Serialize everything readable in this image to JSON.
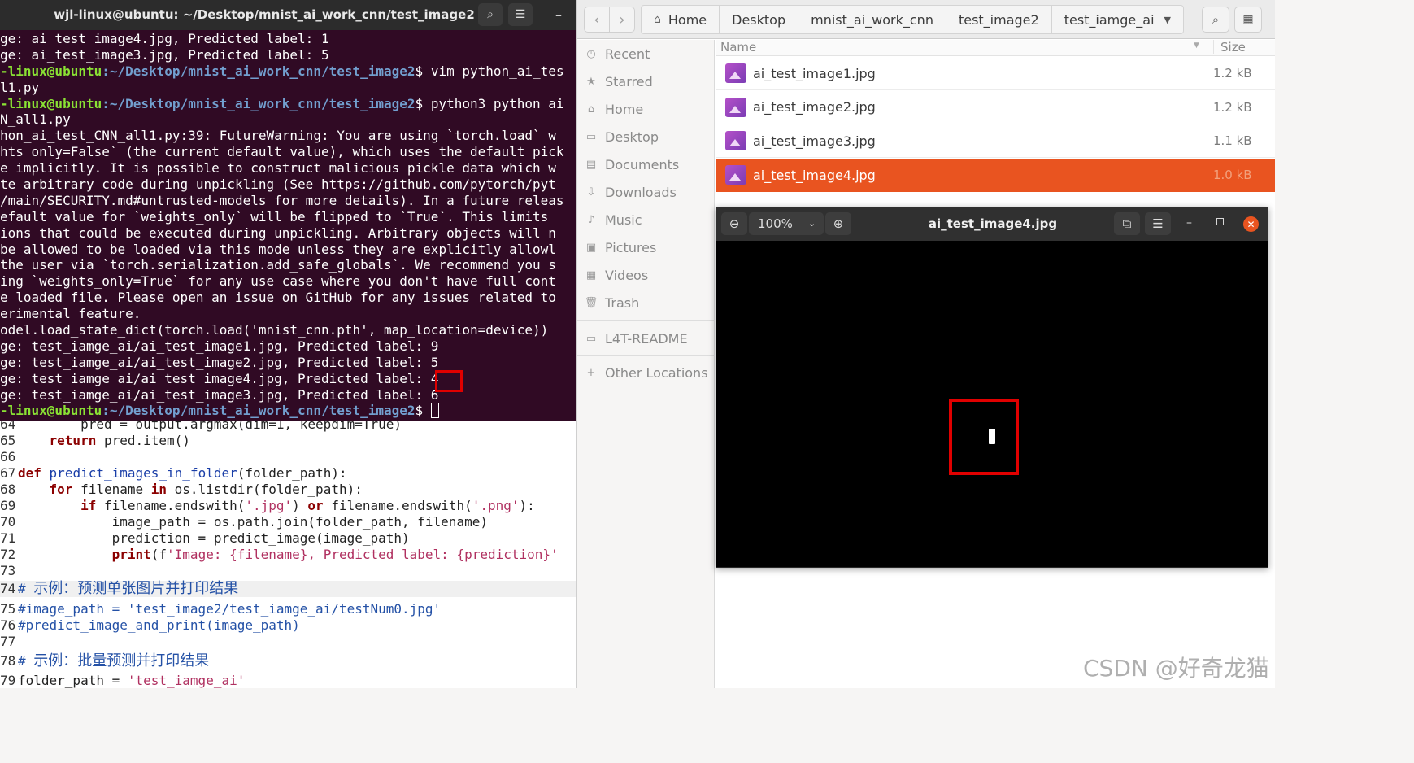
{
  "terminal": {
    "title": "wjl-linux@ubuntu: ~/Desktop/mnist_ai_work_cnn/test_image2",
    "icons": {
      "search": "search-icon",
      "menu": "hamburger-menu-icon",
      "minimize": "minimize-icon"
    },
    "lines": [
      {
        "text": "ge: ai_test_image4.jpg, Predicted label: 1"
      },
      {
        "text": "ge: ai_test_image3.jpg, Predicted label: 5"
      },
      {
        "user": "-linux@ubuntu",
        "path": ":~/Desktop/mnist_ai_work_cnn/test_image2",
        "cmd": "$ vim python_ai_tes"
      },
      {
        "text": "l1.py"
      },
      {
        "user": "-linux@ubuntu",
        "path": ":~/Desktop/mnist_ai_work_cnn/test_image2",
        "cmd": "$ python3 python_ai"
      },
      {
        "text": "N_all1.py"
      },
      {
        "text": "hon_ai_test_CNN_all1.py:39: FutureWarning: You are using `torch.load` w"
      },
      {
        "text": "hts_only=False` (the current default value), which uses the default pick"
      },
      {
        "text": "e implicitly. It is possible to construct malicious pickle data which w"
      },
      {
        "text": "te arbitrary code during unpickling (See https://github.com/pytorch/pyt"
      },
      {
        "text": "/main/SECURITY.md#untrusted-models for more details). In a future releas"
      },
      {
        "text": "efault value for `weights_only` will be flipped to `True`. This limits "
      },
      {
        "text": "ions that could be executed during unpickling. Arbitrary objects will n"
      },
      {
        "text": "be allowed to be loaded via this mode unless they are explicitly allowl"
      },
      {
        "text": "the user via `torch.serialization.add_safe_globals`. We recommend you s"
      },
      {
        "text": "ing `weights_only=True` for any use case where you don't have full cont"
      },
      {
        "text": "e loaded file. Please open an issue on GitHub for any issues related to"
      },
      {
        "text": "erimental feature."
      },
      {
        "text": "odel.load_state_dict(torch.load('mnist_cnn.pth', map_location=device))"
      },
      {
        "text": "ge: test_iamge_ai/ai_test_image1.jpg, Predicted label: 9"
      },
      {
        "text": "ge: test_iamge_ai/ai_test_image2.jpg, Predicted label: 5"
      },
      {
        "text": "ge: test_iamge_ai/ai_test_image4.jpg, Predicted label: 4"
      },
      {
        "text": "ge: test_iamge_ai/ai_test_image3.jpg, Predicted label: 6"
      },
      {
        "user": "-linux@ubuntu",
        "path": ":~/Desktop/mnist_ai_work_cnn/test_image2",
        "cmd": "$ ",
        "cursor": true
      }
    ]
  },
  "editor": {
    "lines": [
      {
        "n": "64",
        "html": "        pred = output.argmax(dim=1, keepdim=True)"
      },
      {
        "n": "65",
        "html": "    <span class=\"kw\">return</span> pred.item()"
      },
      {
        "n": "66",
        "html": ""
      },
      {
        "n": "67",
        "html": "<span class=\"kw\">def</span> <span class=\"fn\">predict_images_in_folder</span>(folder_path):"
      },
      {
        "n": "68",
        "html": "    <span class=\"kw\">for</span> filename <span class=\"kw\">in</span> os.listdir(folder_path):"
      },
      {
        "n": "69",
        "html": "        <span class=\"kw\">if</span> filename.endswith(<span class=\"str\">'.jpg'</span>) <span class=\"kw\">or</span> filename.endswith(<span class=\"str\">'.png'</span>):"
      },
      {
        "n": "70",
        "html": "            image_path = os.path.join(folder_path, filename)"
      },
      {
        "n": "71",
        "html": "            prediction = predict_image(image_path)"
      },
      {
        "n": "72",
        "html": "            <span class=\"kw\">print</span>(f<span class=\"str\">'Image: {filename}, Predicted label: {prediction}'</span>"
      },
      {
        "n": "73",
        "html": ""
      },
      {
        "n": "74",
        "html": "<span class=\"cm\"># <span class=\"cjk\">示例：预测单张图片并打印结果</span></span>",
        "current": true
      },
      {
        "n": "75",
        "html": "<span class=\"cm\">#image_path = 'test_image2/test_iamge_ai/testNum0.jpg'</span>"
      },
      {
        "n": "76",
        "html": "<span class=\"cm\">#predict_image_and_print(image_path)</span>"
      },
      {
        "n": "77",
        "html": ""
      },
      {
        "n": "78",
        "html": "<span class=\"cm\"># <span class=\"cjk\">示例：批量预测并打印结果</span></span>"
      },
      {
        "n": "79",
        "html": "folder_path = <span class=\"str\">'test_iamge_ai'</span>"
      }
    ]
  },
  "file_manager": {
    "breadcrumb": [
      "Home",
      "Desktop",
      "mnist_ai_work_cnn",
      "test_image2",
      "test_iamge_ai"
    ],
    "sidebar": [
      {
        "label": "Recent",
        "icon": "clock-icon",
        "glyph": "◷"
      },
      {
        "label": "Starred",
        "icon": "star-icon",
        "glyph": "★"
      },
      {
        "label": "Home",
        "icon": "home-icon",
        "glyph": "⌂"
      },
      {
        "label": "Desktop",
        "icon": "desktop-icon",
        "glyph": "▭"
      },
      {
        "label": "Documents",
        "icon": "document-icon",
        "glyph": "▤"
      },
      {
        "label": "Downloads",
        "icon": "download-icon",
        "glyph": "⇩"
      },
      {
        "label": "Music",
        "icon": "music-icon",
        "glyph": "♪"
      },
      {
        "label": "Pictures",
        "icon": "picture-icon",
        "glyph": "▣"
      },
      {
        "label": "Videos",
        "icon": "video-icon",
        "glyph": "▦"
      },
      {
        "label": "Trash",
        "icon": "trash-icon",
        "glyph": "🗑"
      },
      {
        "label": "L4T-README",
        "icon": "drive-icon",
        "glyph": "▭"
      },
      {
        "label": "Other Locations",
        "icon": "plus-icon",
        "glyph": "+"
      }
    ],
    "columns": {
      "name": "Name",
      "size": "Size"
    },
    "files": [
      {
        "name": "ai_test_image1.jpg",
        "size": "1.2 kB",
        "selected": false
      },
      {
        "name": "ai_test_image2.jpg",
        "size": "1.2 kB",
        "selected": false
      },
      {
        "name": "ai_test_image3.jpg",
        "size": "1.1 kB",
        "selected": false
      },
      {
        "name": "ai_test_image4.jpg",
        "size": "1.0 kB",
        "selected": true
      }
    ]
  },
  "viewer": {
    "title": "ai_test_image4.jpg",
    "zoom": "100%"
  },
  "watermark": "CSDN @好奇龙猫",
  "colors": {
    "terminal_bg": "#300a24",
    "accent": "#e95420",
    "highlight": "#e00000"
  }
}
